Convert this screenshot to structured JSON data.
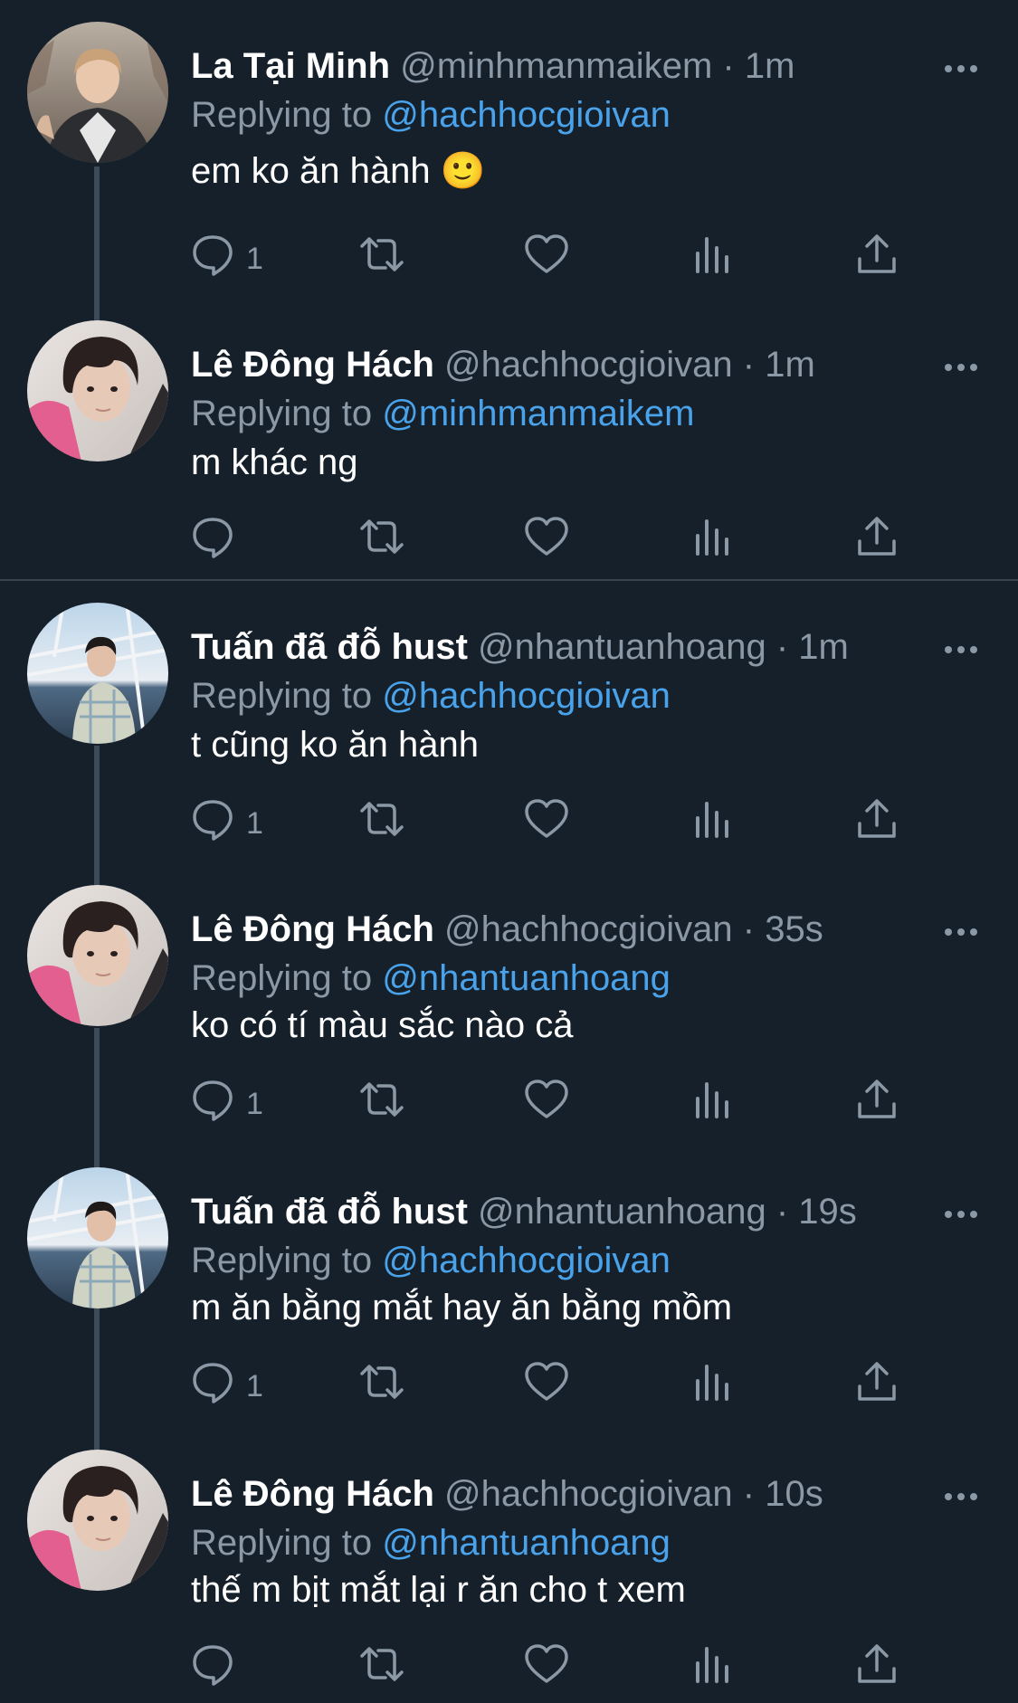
{
  "colors": {
    "background": "#15202b",
    "primary_text": "#ffffff",
    "secondary_text": "#8b98a5",
    "mention": "#4aa3ea",
    "divider": "#38444d"
  },
  "replying_label": "Replying to",
  "icons": {
    "reply": "reply-icon",
    "retweet": "retweet-icon",
    "like": "heart-icon",
    "analytics": "analytics-icon",
    "share": "share-icon",
    "more": "more-options-icon"
  },
  "tweets": [
    {
      "name": "La Tại Minh",
      "handle": "@minhmanmaikem",
      "time": "1m",
      "replying_to": "@hachhocgioivan",
      "text": "em ko ăn hành 🙂",
      "reply_count": "1"
    },
    {
      "name": "Lê Đông Hách",
      "handle": "@hachhocgioivan",
      "time": "1m",
      "replying_to": "@minhmanmaikem",
      "text": "m khác ng",
      "reply_count": ""
    },
    {
      "name": "Tuấn đã đỗ hust",
      "handle": "@nhantuanhoang",
      "time": "1m",
      "replying_to": "@hachhocgioivan",
      "text": "t cũng ko ăn hành",
      "reply_count": "1"
    },
    {
      "name": "Lê Đông Hách",
      "handle": "@hachhocgioivan",
      "time": "35s",
      "replying_to": "@nhantuanhoang",
      "text": "ko có tí màu sắc nào cả",
      "reply_count": "1"
    },
    {
      "name": "Tuấn đã đỗ hust",
      "handle": "@nhantuanhoang",
      "time": "19s",
      "replying_to": "@hachhocgioivan",
      "text": "m ăn bằng mắt hay ăn bằng mồm",
      "reply_count": "1"
    },
    {
      "name": "Lê Đông Hách",
      "handle": "@hachhocgioivan",
      "time": "10s",
      "replying_to": "@nhantuanhoang",
      "text": "thế m bịt mắt lại r ăn cho t xem",
      "reply_count": ""
    }
  ]
}
